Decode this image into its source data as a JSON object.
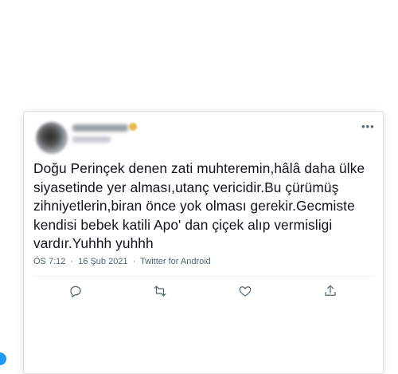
{
  "tweet": {
    "text": "Doğu Perinçek denen zati muhteremin,hâlâ daha ülke\nsiyasetinde yer alması,utanç vericidir.Bu çürümüş\nzihniyetlerin,biran önce yok olması gerekir.Gecmiste\nkendisi bebek katili Apo' dan çiçek alıp vermisligi\nvardır.Yuhhh yuhhh",
    "time": "ÖS 7:12",
    "date": "16 Şub 2021",
    "separator": "·",
    "source": "Twitter for Android"
  },
  "icons": {
    "more": "more-icon",
    "reply": "reply-icon",
    "retweet": "retweet-icon",
    "like": "heart-icon",
    "share": "share-icon"
  },
  "colors": {
    "text": "#0f1419",
    "muted": "#536471",
    "accent": "#1d9bf0"
  }
}
